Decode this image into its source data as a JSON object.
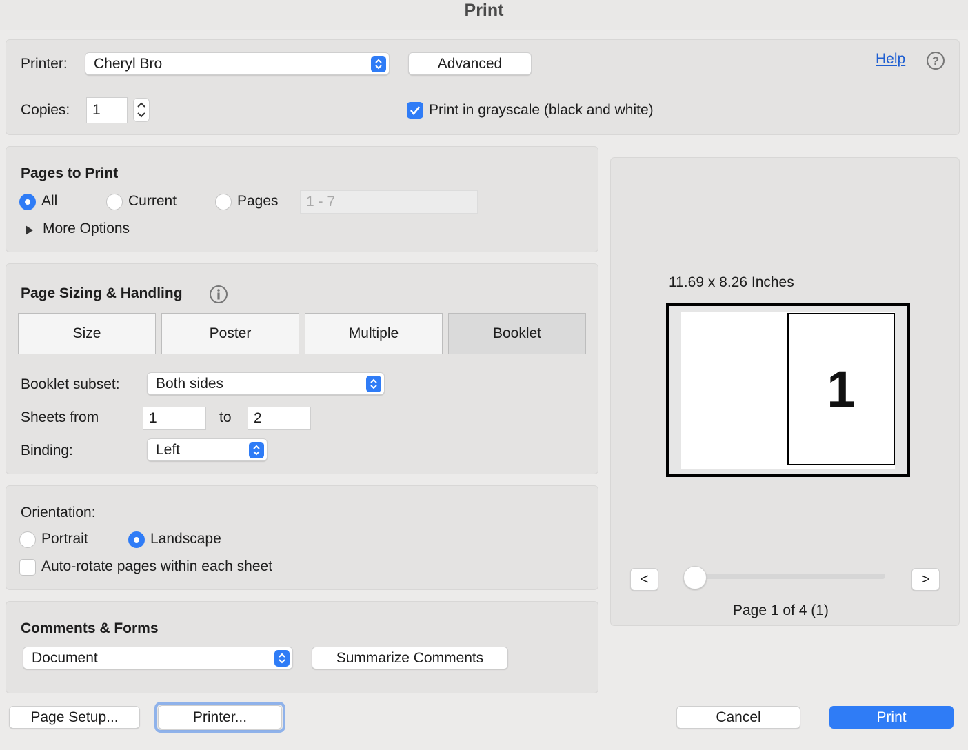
{
  "window": {
    "title": "Print"
  },
  "printer": {
    "label": "Printer:",
    "selected": "Cheryl Bro",
    "advanced_label": "Advanced",
    "help_label": "Help"
  },
  "copies": {
    "label": "Copies:",
    "value": "1",
    "grayscale_label": "Print in grayscale (black and white)",
    "grayscale_checked": true
  },
  "pages_to_print": {
    "heading": "Pages to Print",
    "all_label": "All",
    "current_label": "Current",
    "pages_label": "Pages",
    "pages_placeholder": "1 - 7",
    "selected": "All",
    "more_options_label": "More Options"
  },
  "page_sizing": {
    "heading": "Page Sizing & Handling",
    "tabs": [
      {
        "label": "Size"
      },
      {
        "label": "Poster"
      },
      {
        "label": "Multiple"
      },
      {
        "label": "Booklet"
      }
    ],
    "active_tab": "Booklet",
    "booklet_subset_label": "Booklet subset:",
    "booklet_subset_value": "Both sides",
    "sheets_from_label": "Sheets from",
    "sheets_from_value": "1",
    "to_label": "to",
    "sheets_to_value": "2",
    "binding_label": "Binding:",
    "binding_value": "Left"
  },
  "orientation": {
    "heading": "Orientation:",
    "portrait_label": "Portrait",
    "landscape_label": "Landscape",
    "selected": "Landscape",
    "autorotate_label": "Auto-rotate pages within each sheet",
    "autorotate_checked": false
  },
  "comments_forms": {
    "heading": "Comments & Forms",
    "selected": "Document",
    "summarize_label": "Summarize Comments"
  },
  "preview": {
    "size_text": "11.69 x 8.26 Inches",
    "page_number": "1",
    "prev_label": "<",
    "next_label": ">",
    "page_status": "Page 1 of 4 (1)",
    "slider_position": 0
  },
  "footer": {
    "page_setup_label": "Page Setup...",
    "printer_label": "Printer...",
    "cancel_label": "Cancel",
    "print_label": "Print"
  },
  "colors": {
    "accent": "#2f7cf6",
    "link": "#1f5fd1"
  }
}
